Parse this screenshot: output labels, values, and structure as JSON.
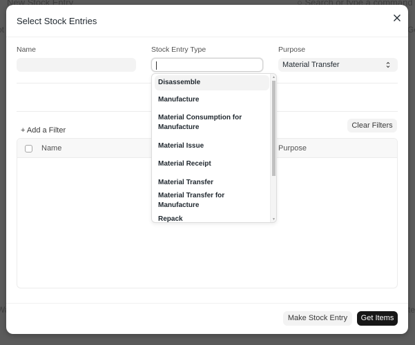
{
  "background": {
    "page_title": "New Stock Entry",
    "search_placeholder": "Search or type a command (Ctrl + G)",
    "left_fragment": "ot",
    "right_fragment": "Ge",
    "left_fragment_2": "Wa",
    "right_fragment_2": "te"
  },
  "modal": {
    "title": "Select Stock Entries",
    "close_icon": "close-icon",
    "fields": {
      "name": {
        "label": "Name",
        "value": ""
      },
      "stock_entry_type": {
        "label": "Stock Entry Type",
        "value": ""
      },
      "purpose": {
        "label": "Purpose",
        "value": "Material Transfer"
      }
    },
    "dropdown": {
      "items": [
        "Disassemble",
        "Manufacture",
        "Material Consumption for Manufacture",
        "Material Issue",
        "Material Receipt",
        "Material Transfer",
        "Material Transfer for Manufacture",
        "Repack"
      ],
      "highlighted_index": 0
    },
    "add_filter_label": "+ Add a Filter",
    "clear_filters_label": "Clear Filters",
    "table": {
      "columns": [
        "Name",
        "Purpose"
      ],
      "rows": []
    },
    "buttons": {
      "secondary": "Make Stock Entry",
      "primary": "Get Items"
    }
  },
  "colors": {
    "primary_button": "#171717",
    "secondary_button": "#f3f3f3",
    "overlay": "#5b5b5b"
  }
}
